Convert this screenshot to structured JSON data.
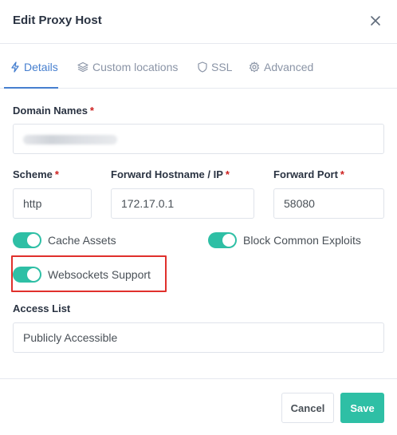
{
  "modal": {
    "title": "Edit Proxy Host",
    "close_icon": "close-icon"
  },
  "tabs": [
    {
      "label": "Details",
      "icon": "bolt-icon",
      "active": true
    },
    {
      "label": "Custom locations",
      "icon": "layers-icon",
      "active": false
    },
    {
      "label": "SSL",
      "icon": "shield-icon",
      "active": false
    },
    {
      "label": "Advanced",
      "icon": "gear-icon",
      "active": false
    }
  ],
  "form": {
    "domain_names": {
      "label": "Domain Names",
      "required": "*"
    },
    "scheme": {
      "label": "Scheme",
      "required": "*",
      "value": "http"
    },
    "forward_host": {
      "label": "Forward Hostname / IP",
      "required": "*",
      "value": "172.17.0.1"
    },
    "forward_port": {
      "label": "Forward Port",
      "required": "*",
      "value": "58080"
    },
    "cache_assets": {
      "label": "Cache Assets",
      "enabled": true
    },
    "block_exploits": {
      "label": "Block Common Exploits",
      "enabled": true
    },
    "websockets": {
      "label": "Websockets Support",
      "enabled": true
    },
    "access_list": {
      "label": "Access List",
      "value": "Publicly Accessible"
    }
  },
  "footer": {
    "cancel_label": "Cancel",
    "save_label": "Save"
  },
  "colors": {
    "accent": "#467fcf",
    "toggle_on": "#2ebfa5",
    "required": "#cd201f",
    "highlight": "#e0302c"
  }
}
